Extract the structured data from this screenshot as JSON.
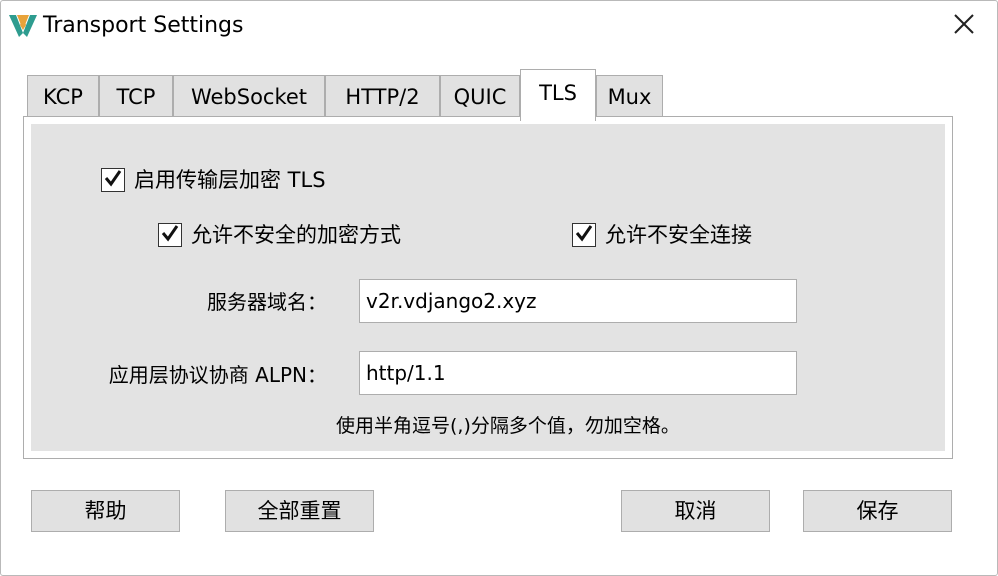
{
  "window": {
    "title": "Transport Settings",
    "icon": "v-logo-icon",
    "close_icon": "close-icon"
  },
  "tabs": [
    {
      "label": "KCP",
      "active": false
    },
    {
      "label": "TCP",
      "active": false
    },
    {
      "label": "WebSocket",
      "active": false
    },
    {
      "label": "HTTP/2",
      "active": false
    },
    {
      "label": "QUIC",
      "active": false
    },
    {
      "label": "TLS",
      "active": true
    },
    {
      "label": "Mux",
      "active": false
    }
  ],
  "tls": {
    "enable_tls": {
      "label": "启用传输层加密 TLS",
      "checked": true
    },
    "allow_insecure_ciphers": {
      "label": "允许不安全的加密方式",
      "checked": true
    },
    "allow_insecure": {
      "label": "允许不安全连接",
      "checked": true
    },
    "server_name": {
      "label": "服务器域名：",
      "value": "v2r.vdjango2.xyz"
    },
    "alpn": {
      "label": "应用层协议协商 ALPN：",
      "value": "http/1.1"
    },
    "alpn_hint": "使用半角逗号(,)分隔多个值，勿加空格。"
  },
  "buttons": {
    "help": "帮助",
    "reset_all": "全部重置",
    "cancel": "取消",
    "save": "保存"
  },
  "colors": {
    "logo_teal": "#2e9c8f",
    "logo_gold": "#e8a33a",
    "panel_bg": "#e3e3e3",
    "button_bg": "#e1e1e1"
  }
}
